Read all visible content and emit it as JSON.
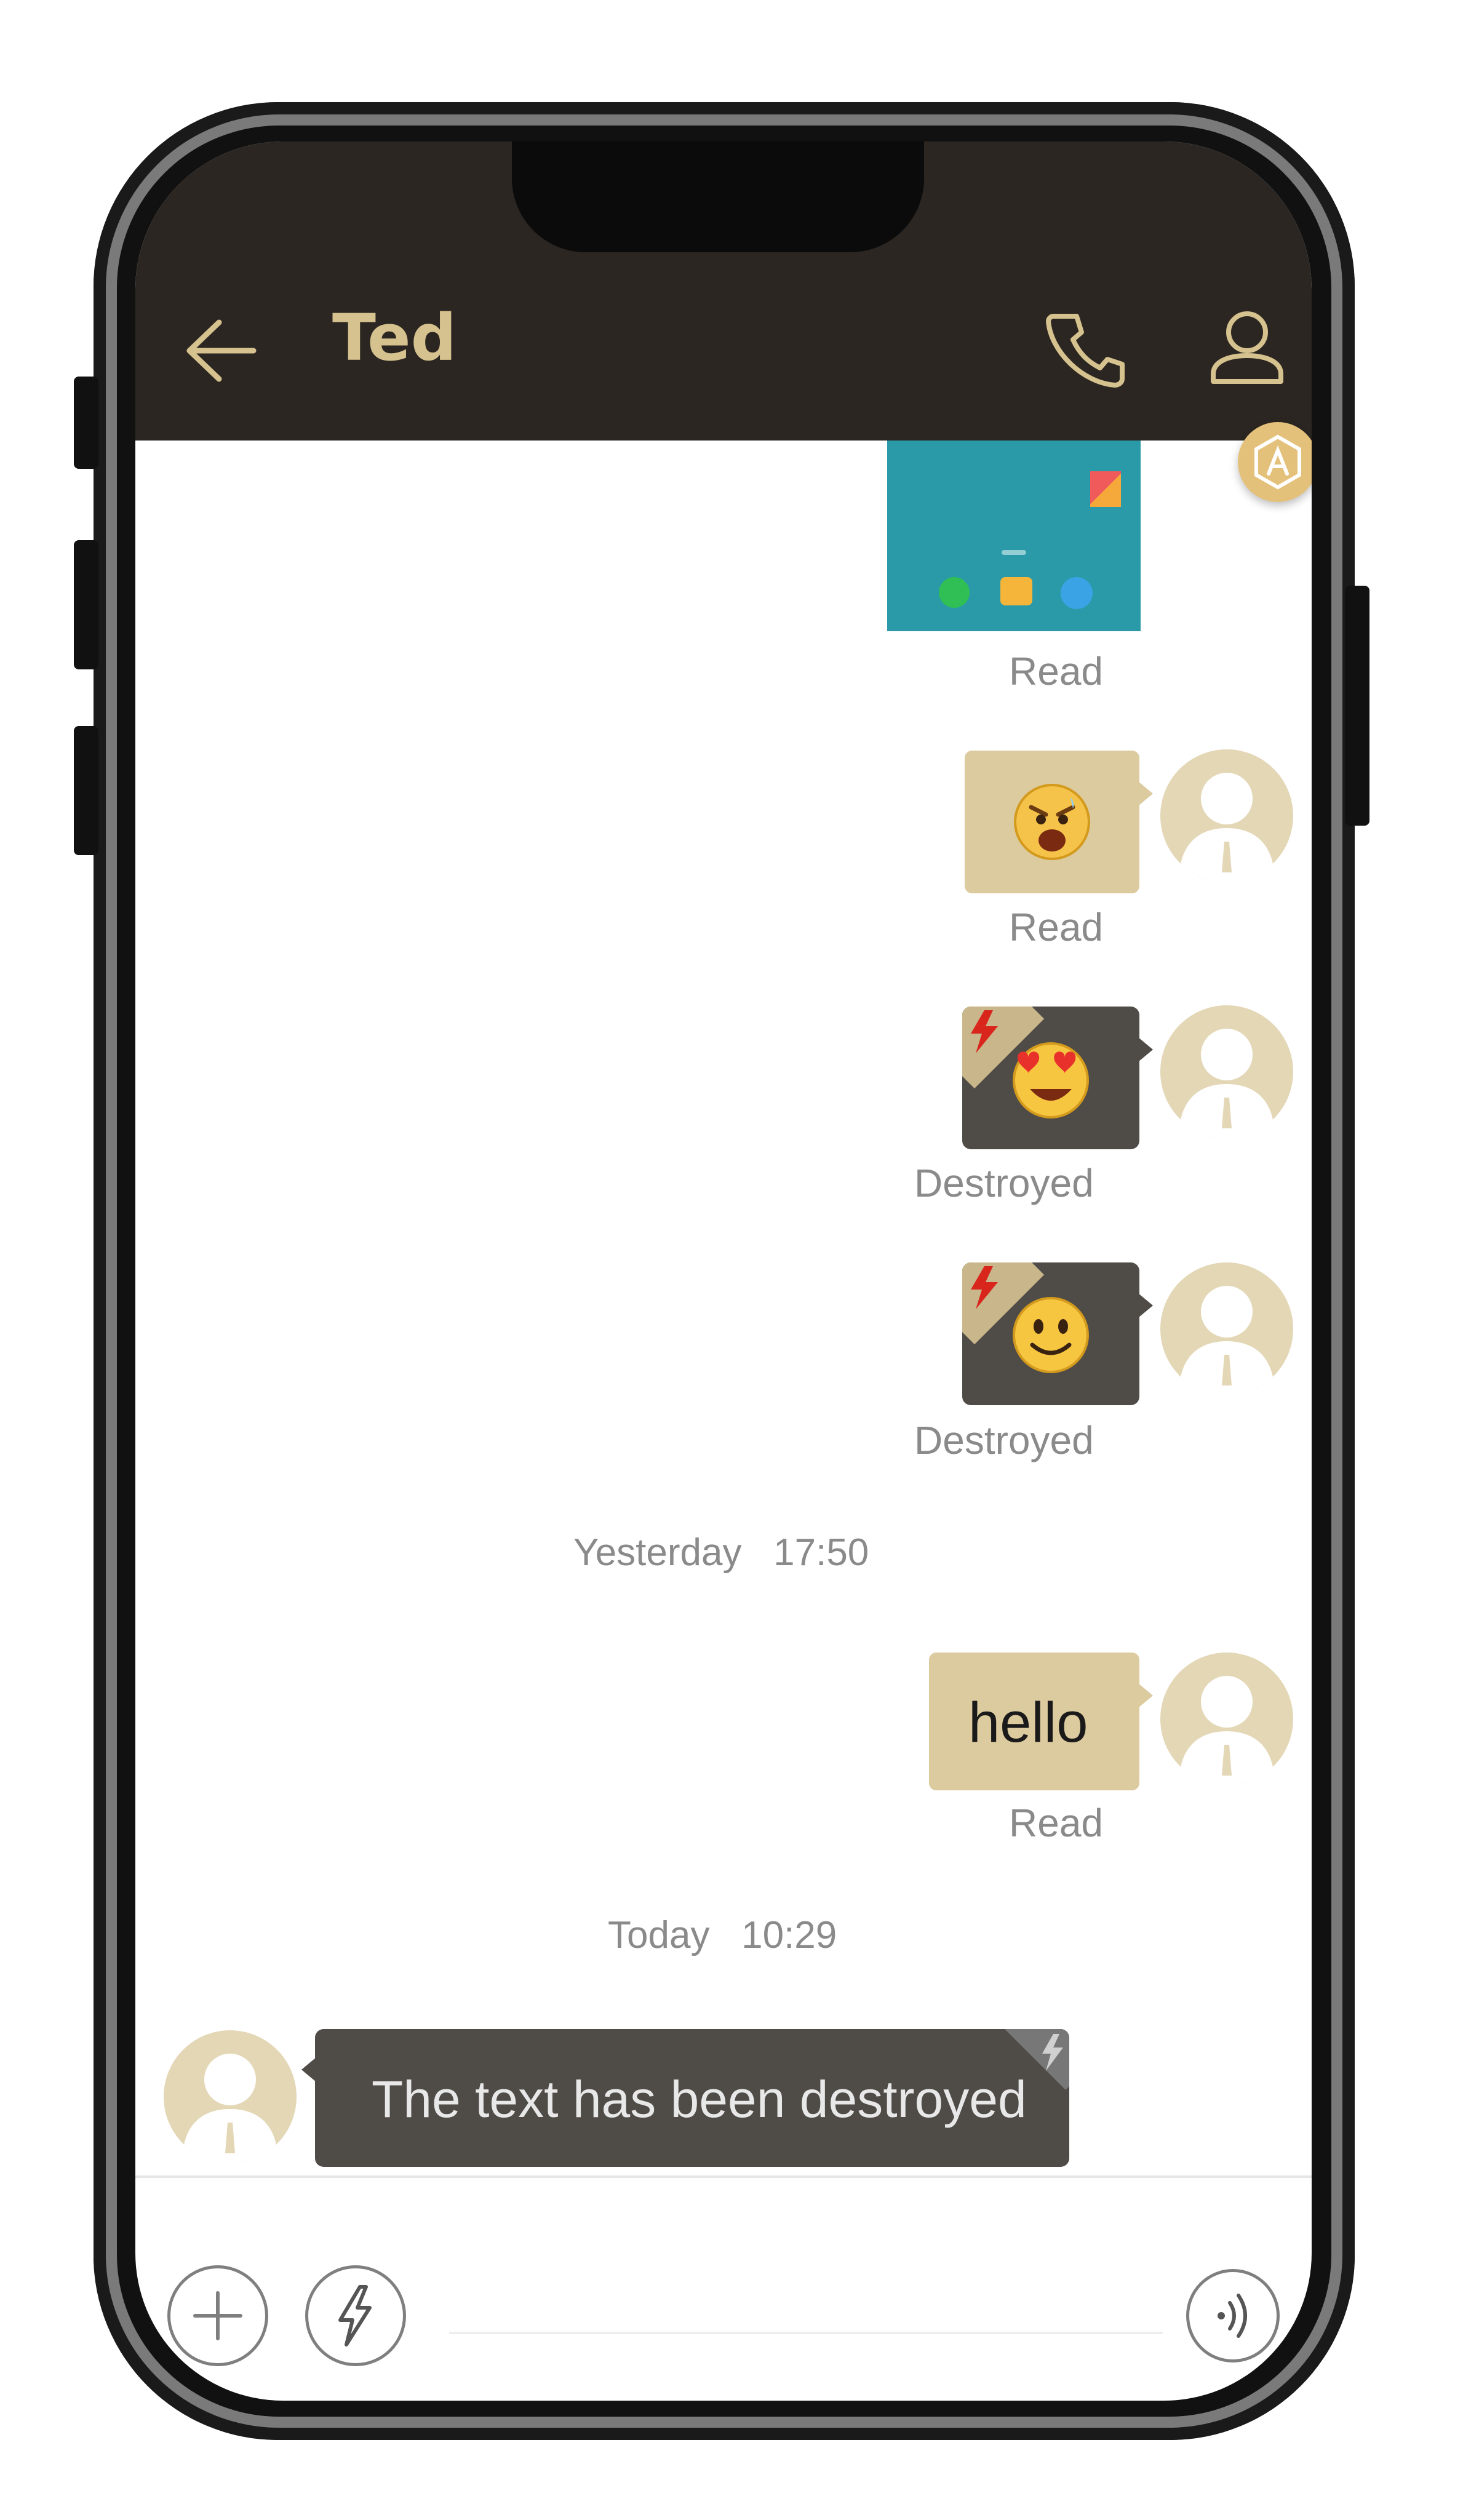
{
  "header": {
    "title": "Ted"
  },
  "messages": {
    "m1_status": "Read",
    "m2_status": "Read",
    "m3_status": "Destroyed",
    "m4_status": "Destroyed",
    "time1": "Yesterday   17:50",
    "m5_text": "hello",
    "m5_status": "Read",
    "time2": "Today   10:29",
    "m6_text": "The text has been destroyed"
  },
  "icons": {
    "back": "arrow-left-icon",
    "call": "phone-icon",
    "contact": "person-icon",
    "badge": "a-badge-icon",
    "plus": "plus-icon",
    "burn": "lightning-icon",
    "voice": "voice-wave-icon"
  },
  "colors": {
    "header_bg": "#2b2621",
    "accent_gold": "#d6c28e",
    "bubble_gold": "#dccb9e",
    "bubble_dark": "#4f4b47"
  }
}
